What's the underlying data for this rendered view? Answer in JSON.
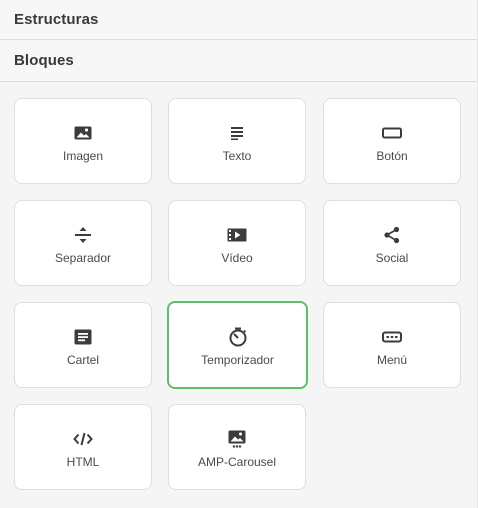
{
  "sections": {
    "structures_label": "Estructuras",
    "blocks_label": "Bloques"
  },
  "blocks": [
    {
      "label": "Imagen",
      "icon": "image-icon"
    },
    {
      "label": "Texto",
      "icon": "text-icon"
    },
    {
      "label": "Botón",
      "icon": "button-icon"
    },
    {
      "label": "Separador",
      "icon": "separator-icon"
    },
    {
      "label": "Vídeo",
      "icon": "video-icon"
    },
    {
      "label": "Social",
      "icon": "share-icon"
    },
    {
      "label": "Cartel",
      "icon": "banner-icon"
    },
    {
      "label": "Temporizador",
      "icon": "timer-icon"
    },
    {
      "label": "Menú",
      "icon": "menu-icon"
    },
    {
      "label": "HTML",
      "icon": "code-icon"
    },
    {
      "label": "AMP-Carousel",
      "icon": "carousel-icon"
    }
  ],
  "colors": {
    "icon": "#3c3c3c",
    "active_border": "#5cbf6a",
    "tile_border": "#dedede",
    "panel_bg": "#f5f5f5"
  }
}
